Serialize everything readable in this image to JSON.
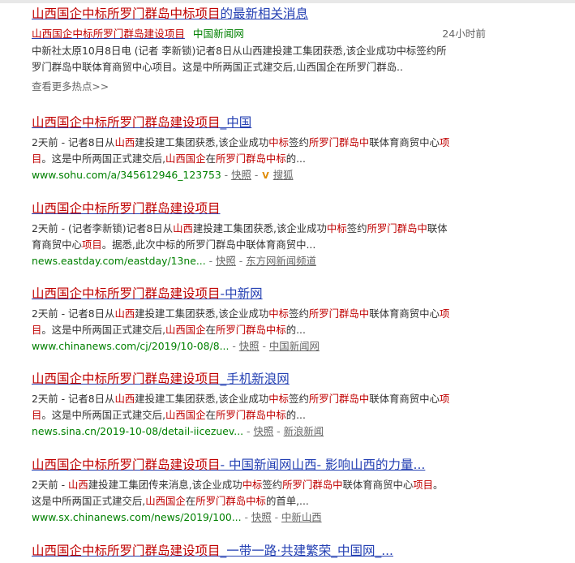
{
  "news_card": {
    "title": {
      "hl": "山西国企中标所罗门群岛中标项目",
      "rest": "的最新相关消息"
    },
    "item": {
      "title": {
        "hl": "山西国企中标所罗门群岛建设项目"
      },
      "source": "中国新闻网",
      "time": "24小时前",
      "snippet_lines": [
        "中新社太原10月8日电 (记者 李新锁)记者8日从山西建投建工集团获悉,该企业成功中标签约所",
        "罗门群岛中联体育商贸中心项目。这是中所两国正式建交后,山西国企在所罗门群岛.."
      ]
    },
    "more_link": "查看更多热点>>"
  },
  "results": [
    {
      "title": {
        "hl": "山西国企中标所罗门群岛建设项目",
        "rest": "_中国"
      },
      "lines": [
        [
          {
            "t": "2天前 - 记者8日从"
          },
          {
            "t": "山西",
            "em": true
          },
          {
            "t": "建投建工集团获悉,该企业成功"
          },
          {
            "t": "中标",
            "em": true
          },
          {
            "t": "签约"
          },
          {
            "t": "所罗门群岛中",
            "em": true
          },
          {
            "t": "联体育商贸中心"
          },
          {
            "t": "项",
            "em": true
          }
        ],
        [
          {
            "t": "目",
            "em": true
          },
          {
            "t": "。这是中所两国正式建交后,"
          },
          {
            "t": "山西国企",
            "em": true
          },
          {
            "t": "在"
          },
          {
            "t": "所罗门群岛中标",
            "em": true
          },
          {
            "t": "的..."
          }
        ]
      ],
      "url": "www.sohu.com/a/345612946_123753",
      "snapshot": "快照",
      "source": "搜狐",
      "has_v_icon": true
    },
    {
      "title": {
        "hl": "山西国企中标所罗门群岛建设项目",
        "rest": ""
      },
      "lines": [
        [
          {
            "t": "2天前 - (记者李新锁)记者8日从"
          },
          {
            "t": "山西",
            "em": true
          },
          {
            "t": "建投建工集团获悉,该企业成功"
          },
          {
            "t": "中标",
            "em": true
          },
          {
            "t": "签约"
          },
          {
            "t": "所罗门群岛中",
            "em": true
          },
          {
            "t": "联体"
          }
        ],
        [
          {
            "t": "育商贸中心"
          },
          {
            "t": "项目",
            "em": true
          },
          {
            "t": "。据悉,此次中标的所罗门群岛中联体育商贸中..."
          }
        ]
      ],
      "url": "news.eastday.com/eastday/13ne...",
      "snapshot": "快照",
      "source": "东方网新闻频道",
      "has_v_icon": false
    },
    {
      "title": {
        "hl": "山西国企中标所罗门群岛建设项目",
        "rest": "-中新网"
      },
      "lines": [
        [
          {
            "t": "2天前 - 记者8日从"
          },
          {
            "t": "山西",
            "em": true
          },
          {
            "t": "建投建工集团获悉,该企业成功"
          },
          {
            "t": "中标",
            "em": true
          },
          {
            "t": "签约"
          },
          {
            "t": "所罗门群岛中",
            "em": true
          },
          {
            "t": "联体育商贸中心"
          },
          {
            "t": "项",
            "em": true
          }
        ],
        [
          {
            "t": "目",
            "em": true
          },
          {
            "t": "。这是中所两国正式建交后,"
          },
          {
            "t": "山西国企",
            "em": true
          },
          {
            "t": "在"
          },
          {
            "t": "所罗门群岛中标",
            "em": true
          },
          {
            "t": "的..."
          }
        ]
      ],
      "url": "www.chinanews.com/cj/2019/10-08/8...",
      "snapshot": "快照",
      "source": "中国新闻网",
      "has_v_icon": false
    },
    {
      "title": {
        "hl": "山西国企中标所罗门群岛建设项目",
        "rest": "_手机新浪网"
      },
      "lines": [
        [
          {
            "t": "2天前 - 记者8日从"
          },
          {
            "t": "山西",
            "em": true
          },
          {
            "t": "建投建工集团获悉,该企业成功"
          },
          {
            "t": "中标",
            "em": true
          },
          {
            "t": "签约"
          },
          {
            "t": "所罗门群岛中",
            "em": true
          },
          {
            "t": "联体育商贸中心"
          },
          {
            "t": "项",
            "em": true
          }
        ],
        [
          {
            "t": "目",
            "em": true
          },
          {
            "t": "。这是中所两国正式建交后,"
          },
          {
            "t": "山西国企",
            "em": true
          },
          {
            "t": "在"
          },
          {
            "t": "所罗门群岛中标",
            "em": true
          },
          {
            "t": "的..."
          }
        ]
      ],
      "url": "news.sina.cn/2019-10-08/detail-iicezuev...",
      "snapshot": "快照",
      "source": "新浪新闻",
      "has_v_icon": false
    },
    {
      "title": {
        "hl": "山西国企中标所罗门群岛建设项目",
        "rest": "- 中国新闻网山西- 影响山西的力量..."
      },
      "lines": [
        [
          {
            "t": "2天前 - "
          },
          {
            "t": "山西",
            "em": true
          },
          {
            "t": "建投建工集团传来消息,该企业成功"
          },
          {
            "t": "中标",
            "em": true
          },
          {
            "t": "签约"
          },
          {
            "t": "所罗门群岛中",
            "em": true
          },
          {
            "t": "联体育商贸中心"
          },
          {
            "t": "项目",
            "em": true
          },
          {
            "t": "。"
          }
        ],
        [
          {
            "t": "这是中所两国正式建交后,"
          },
          {
            "t": "山西国企",
            "em": true
          },
          {
            "t": "在"
          },
          {
            "t": "所罗门群岛中标",
            "em": true
          },
          {
            "t": "的首单,..."
          }
        ]
      ],
      "url": "www.sx.chinanews.com/news/2019/100...",
      "snapshot": "快照",
      "source": "中新山西",
      "has_v_icon": false
    },
    {
      "title": {
        "hl": "山西国企中标所罗门群岛建设项目",
        "rest": "_一带一路·共建繁荣_中国网_..."
      },
      "lines": [],
      "url": "",
      "snapshot": "",
      "source": "",
      "has_v_icon": false
    }
  ],
  "colors": {
    "title_link": "#2440b3",
    "highlight": "#c00000",
    "url_green": "#008000"
  }
}
